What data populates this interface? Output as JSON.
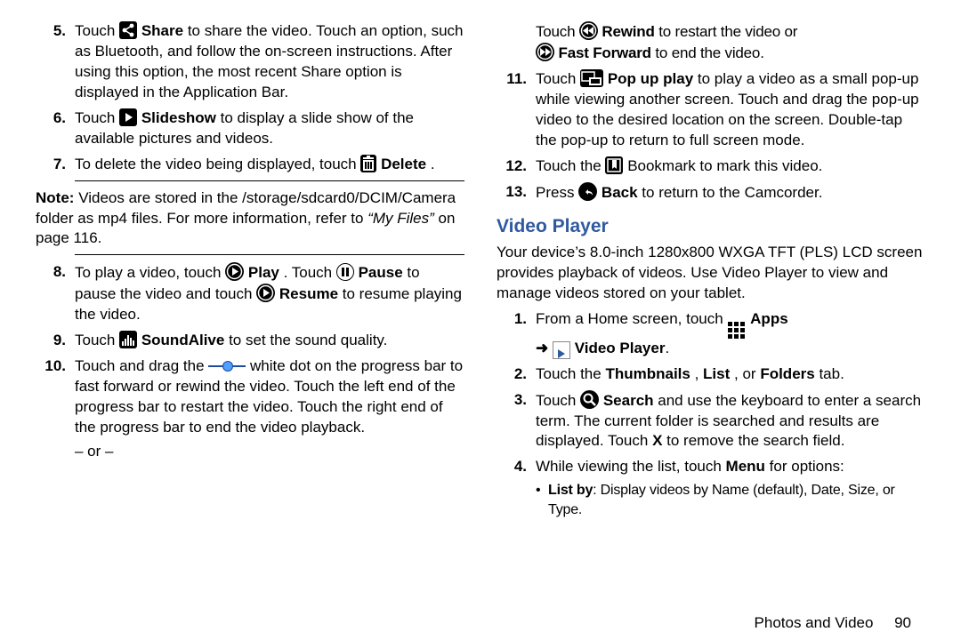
{
  "left": {
    "i5": {
      "pre": "Touch ",
      "share": " Share",
      "rest": " to share the video. Touch an option, such as Bluetooth, and follow the on-screen instructions. After using this option, the most recent Share option is displayed in the Application Bar."
    },
    "i6": {
      "pre": "Touch ",
      "slide": " Slideshow",
      "rest": " to display a slide show of the available pictures and videos."
    },
    "i7": {
      "pre": "To delete the video being displayed, touch ",
      "del": " Delete",
      "dot": "."
    },
    "note_label": "Note:",
    "note_body_a": " Videos are stored in the /storage/sdcard0/DCIM/Camera folder as mp4 files. For more information, refer to ",
    "note_body_b": "“My Files”",
    "note_body_c": " on page 116.",
    "i8": {
      "a": "To play a video, touch ",
      "play": " Play",
      "b": ". Touch ",
      "pause": " Pause",
      "c": " to pause the video and touch ",
      "resume": " Resume",
      "d": " to resume playing the video."
    },
    "i9": {
      "a": "Touch ",
      "sa": " SoundAlive",
      "b": " to set the sound quality."
    },
    "i10": {
      "a": "Touch and drag the ",
      "b": " white dot on the progress bar to fast forward or rewind the video. Touch the left end of the progress bar to restart the video. Touch the right end of the progress bar to end the video playback.",
      "or": "– or –"
    }
  },
  "right": {
    "top": {
      "a": "Touch ",
      "rw": " Rewind",
      "b": " to restart the video or",
      "ff": " Fast Forward",
      "c": " to end the video."
    },
    "i11": {
      "a": "Touch ",
      "pu": " Pop up play",
      "b": " to play a video as a small pop-up while viewing another screen. Touch and drag the pop-up video to the desired location on the screen. Double-tap the pop-up to return to full screen mode."
    },
    "i12": {
      "a": "Touch the ",
      "b": " Bookmark to mark this video."
    },
    "i13": {
      "a": "Press ",
      "bk": " Back",
      "b": " to return to the Camcorder."
    },
    "h2": "Video Player",
    "para": "Your device’s 8.0-inch 1280x800 WXGA TFT (PLS) LCD screen provides playback of videos. Use Video Player to view and manage videos stored on your tablet.",
    "s1": {
      "a": "From a Home screen, touch ",
      "apps": " Apps",
      "arrow": "➜ ",
      "vp": " Video Player",
      "dot": "."
    },
    "s2": {
      "a": "Touch the ",
      "th": "Thumbnails",
      "c1": ", ",
      "li": "List",
      "c2": ", or ",
      "fo": "Folders",
      "b": " tab."
    },
    "s3": {
      "a": "Touch ",
      "se": " Search",
      "b": " and use the keyboard to enter a search term. The current folder is searched and results are displayed. Touch ",
      "x": "X",
      "c": " to remove the search field."
    },
    "s4": {
      "a": "While viewing the list, touch ",
      "menu": " Menu",
      "b": " for options:"
    },
    "bullet": {
      "lb": "List by",
      "txt": ": Display videos by Name (default), Date, Size, or Type."
    }
  },
  "footer": {
    "section": "Photos and Video",
    "page": "90"
  },
  "nums": {
    "n5": "5.",
    "n6": "6.",
    "n7": "7.",
    "n8": "8.",
    "n9": "9.",
    "n10": "10.",
    "n11": "11.",
    "n12": "12.",
    "n13": "13.",
    "s1": "1.",
    "s2": "2.",
    "s3": "3.",
    "s4": "4.",
    "bull": "• "
  }
}
